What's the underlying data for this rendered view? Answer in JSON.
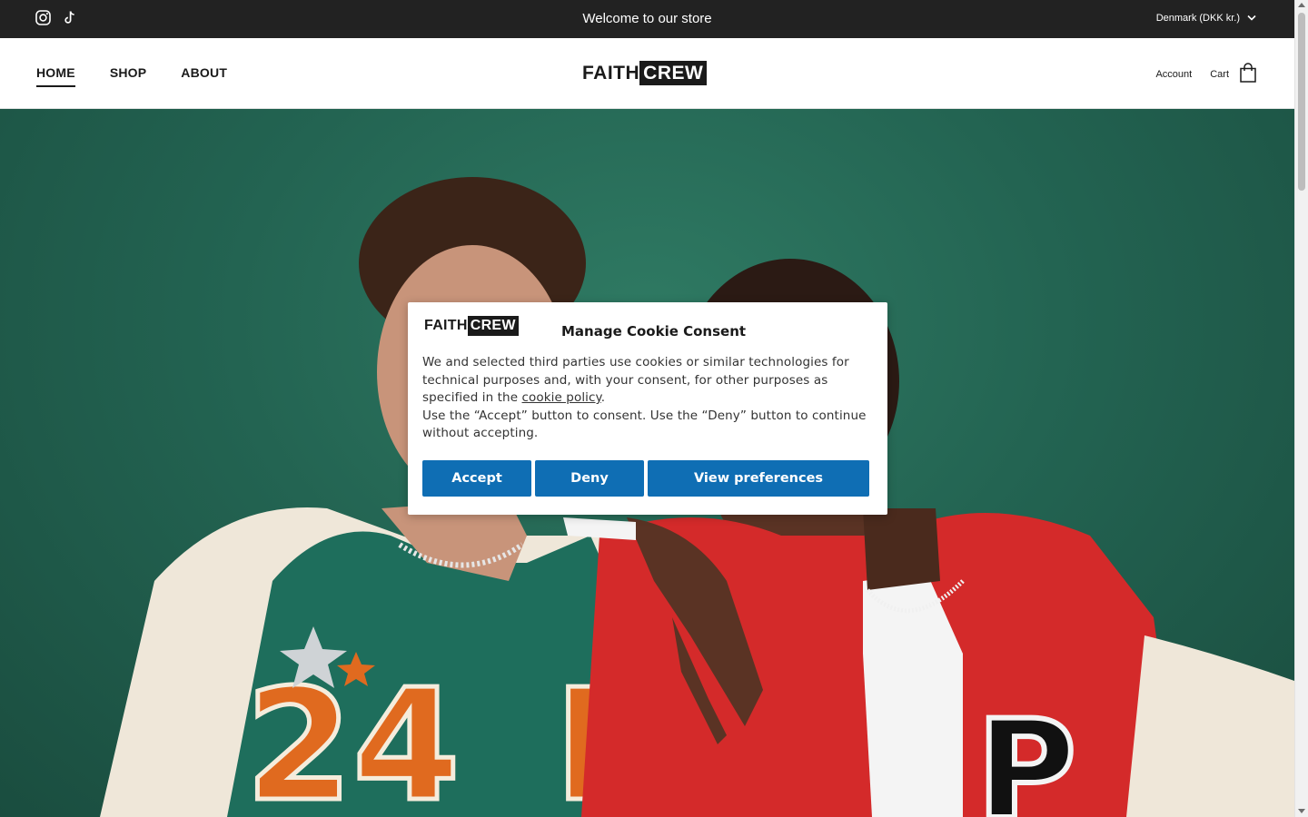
{
  "announcement": {
    "message": "Welcome to our store",
    "region": "Denmark (DKK kr.)",
    "socials": [
      "instagram-icon",
      "tiktok-icon"
    ]
  },
  "header": {
    "nav": [
      {
        "label": "HOME",
        "active": true
      },
      {
        "label": "SHOP",
        "active": false
      },
      {
        "label": "ABOUT",
        "active": false
      }
    ],
    "logo": {
      "part1": "FAITH",
      "part2": "CREW"
    },
    "account_label": "Account",
    "cart_label": "Cart"
  },
  "cookie": {
    "logo": {
      "part1": "FAITH",
      "part2": "CREW"
    },
    "title": "Manage Cookie Consent",
    "text_before_link": "We and selected third parties use cookies or similar technologies for technical purposes and, with your consent, for other purposes as specified in the ",
    "link_text": "cookie policy",
    "text_after_link": ".",
    "text_line2": "Use the “Accept” button to consent. Use the “Deny” button to continue without accepting.",
    "accept_label": "Accept",
    "deny_label": "Deny",
    "preferences_label": "View preferences"
  },
  "colors": {
    "topbar": "#222222",
    "accent_button": "#0f6eb4",
    "hero_green": "#236452",
    "jacket_red": "#d42a2a",
    "jacket_green": "#1e6e5c"
  }
}
